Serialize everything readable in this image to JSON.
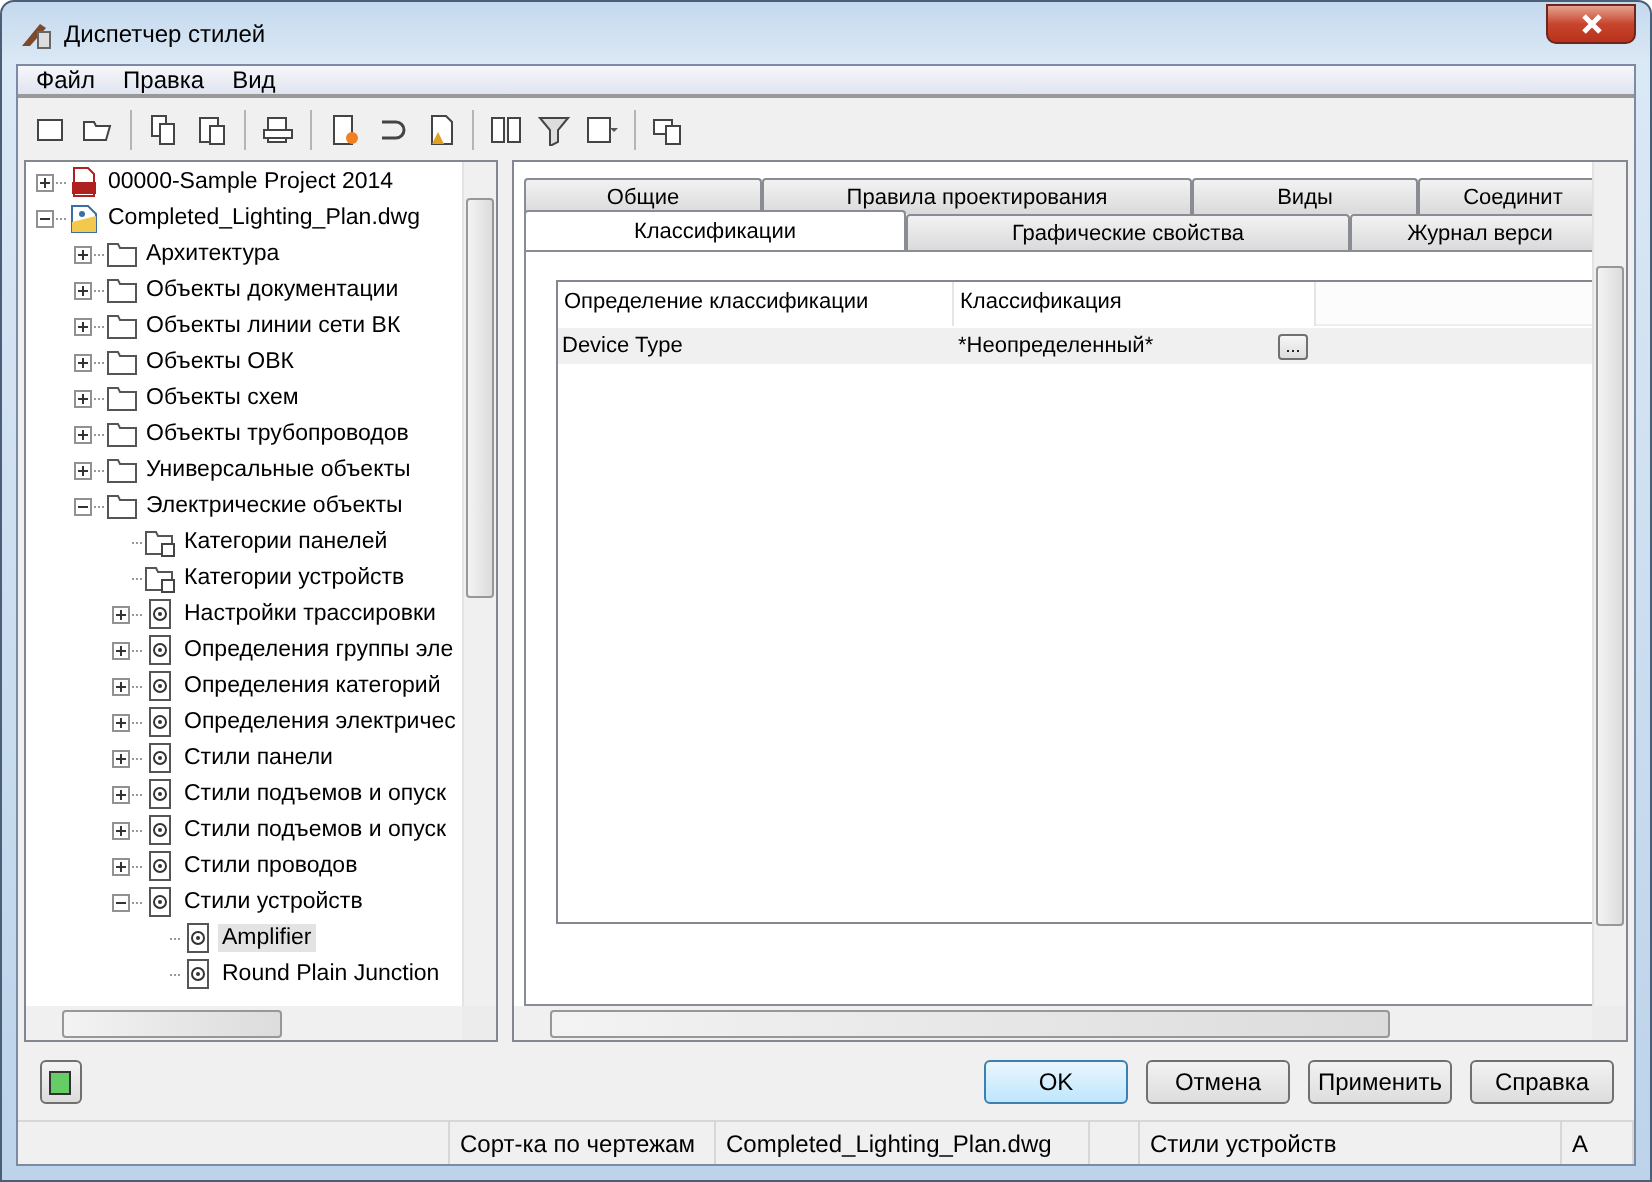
{
  "window": {
    "title": "Диспетчер стилей"
  },
  "menu": [
    "Файл",
    "Правка",
    "Вид"
  ],
  "tree": [
    {
      "label": "00000-Sample Project 2014",
      "kind": "project",
      "expanded": false,
      "selected": false
    },
    {
      "label": "Completed_Lighting_Plan.dwg",
      "kind": "drawing",
      "expanded": true,
      "selected": false,
      "children": [
        {
          "label": "Архитектура",
          "kind": "folder",
          "expanded": false,
          "selected": false
        },
        {
          "label": "Объекты документации",
          "kind": "folder",
          "expanded": false,
          "selected": false
        },
        {
          "label": "Объекты линии сети ВК",
          "kind": "folder",
          "expanded": false,
          "selected": false
        },
        {
          "label": "Объекты ОВК",
          "kind": "folder",
          "expanded": false,
          "selected": false
        },
        {
          "label": "Объекты схем",
          "kind": "folder",
          "expanded": false,
          "selected": false
        },
        {
          "label": "Объекты трубопроводов",
          "kind": "folder",
          "expanded": false,
          "selected": false
        },
        {
          "label": "Универсальные объекты",
          "kind": "folder",
          "expanded": false,
          "selected": false
        },
        {
          "label": "Электрические объекты",
          "kind": "folder",
          "expanded": true,
          "selected": false,
          "children": [
            {
              "label": "Категории панелей",
              "kind": "category",
              "selected": false
            },
            {
              "label": "Категории устройств",
              "kind": "category",
              "selected": false
            },
            {
              "label": "Настройки трассировки",
              "kind": "style",
              "expanded": false,
              "selected": false
            },
            {
              "label": "Определения группы эле",
              "kind": "style",
              "expanded": false,
              "selected": false
            },
            {
              "label": "Определения категорий",
              "kind": "style",
              "expanded": false,
              "selected": false
            },
            {
              "label": "Определения электричес",
              "kind": "style",
              "expanded": false,
              "selected": false
            },
            {
              "label": "Стили панели",
              "kind": "style",
              "expanded": false,
              "selected": false
            },
            {
              "label": "Стили подъемов и опуск",
              "kind": "style",
              "expanded": false,
              "selected": false
            },
            {
              "label": "Стили подъемов и опуск",
              "kind": "style",
              "expanded": false,
              "selected": false
            },
            {
              "label": "Стили проводов",
              "kind": "style",
              "expanded": false,
              "selected": false
            },
            {
              "label": "Стили устройств",
              "kind": "style",
              "expanded": true,
              "selected": false,
              "children": [
                {
                  "label": "Amplifier",
                  "kind": "style",
                  "selected": true
                },
                {
                  "label": "Round Plain Junction",
                  "kind": "style",
                  "selected": false
                }
              ]
            }
          ]
        }
      ]
    }
  ],
  "tabs_back": [
    {
      "label": "Общие",
      "selected": false
    },
    {
      "label": "Правила проектирования",
      "selected": false
    },
    {
      "label": "Виды",
      "selected": false
    },
    {
      "label": "Соединит",
      "selected": false
    }
  ],
  "tabs_front": [
    {
      "label": "Классификации",
      "selected": true
    },
    {
      "label": "Графические свойства",
      "selected": false
    },
    {
      "label": "Журнал верси",
      "selected": false
    }
  ],
  "table": {
    "columns": [
      "Определение классификации",
      "Классификация"
    ],
    "rows": [
      {
        "cells": [
          "Device Type",
          "*Неопределенный*"
        ],
        "button": "..."
      }
    ]
  },
  "buttons": [
    {
      "label": "OK",
      "default": true
    },
    {
      "label": "Отмена",
      "default": false
    },
    {
      "label": "Применить",
      "default": false
    },
    {
      "label": "Справка",
      "default": false
    }
  ],
  "status_bar": [
    "Сорт-ка по чертежам",
    "Completed_Lighting_Plan.dwg",
    "Стили устройств",
    "A"
  ]
}
